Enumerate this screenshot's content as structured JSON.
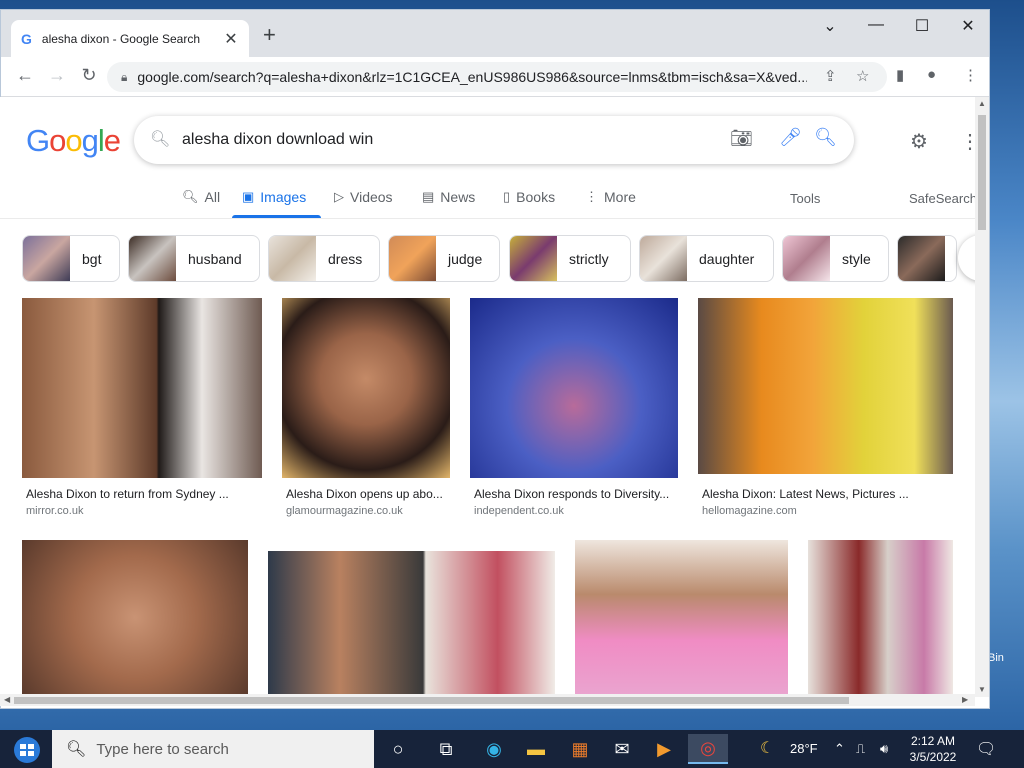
{
  "browser": {
    "tab_title": "alesha dixon - Google Search",
    "url": "google.com/search?q=alesha+dixon&rlz=1C1GCEA_enUS986US986&source=lnms&tbm=isch&sa=X&ved..."
  },
  "search": {
    "query": "alesha dixon download win"
  },
  "logo_letters": [
    "G",
    "o",
    "o",
    "g",
    "l",
    "e"
  ],
  "logo_colors": [
    "#4285f4",
    "#ea4335",
    "#fbbc05",
    "#4285f4",
    "#34a853",
    "#ea4335"
  ],
  "search_tabs": [
    {
      "label": "All",
      "icon": "search-icon"
    },
    {
      "label": "Images",
      "icon": "image-icon",
      "active": true
    },
    {
      "label": "Videos",
      "icon": "play-icon"
    },
    {
      "label": "News",
      "icon": "news-icon"
    },
    {
      "label": "Books",
      "icon": "book-icon"
    },
    {
      "label": "More",
      "icon": "more-vert-icon"
    }
  ],
  "tools_label": "Tools",
  "safesearch_label": "SafeSearch",
  "chips": [
    "bgt",
    "husband",
    "dress",
    "judge",
    "strictly",
    "daughter",
    "style"
  ],
  "results": [
    {
      "caption": "Alesha Dixon to return from Sydney ...",
      "source": "mirror.co.uk"
    },
    {
      "caption": "Alesha Dixon opens up abo...",
      "source": "glamourmagazine.co.uk"
    },
    {
      "caption": "Alesha Dixon responds to Diversity...",
      "source": "independent.co.uk"
    },
    {
      "caption": "Alesha Dixon: Latest News, Pictures ...",
      "source": "hellomagazine.com"
    }
  ],
  "taskbar": {
    "search_placeholder": "Type here to search",
    "temperature": "28°F",
    "time": "2:12 AM",
    "date": "3/5/2022"
  },
  "desktop": {
    "recycle_label": "Bin"
  }
}
